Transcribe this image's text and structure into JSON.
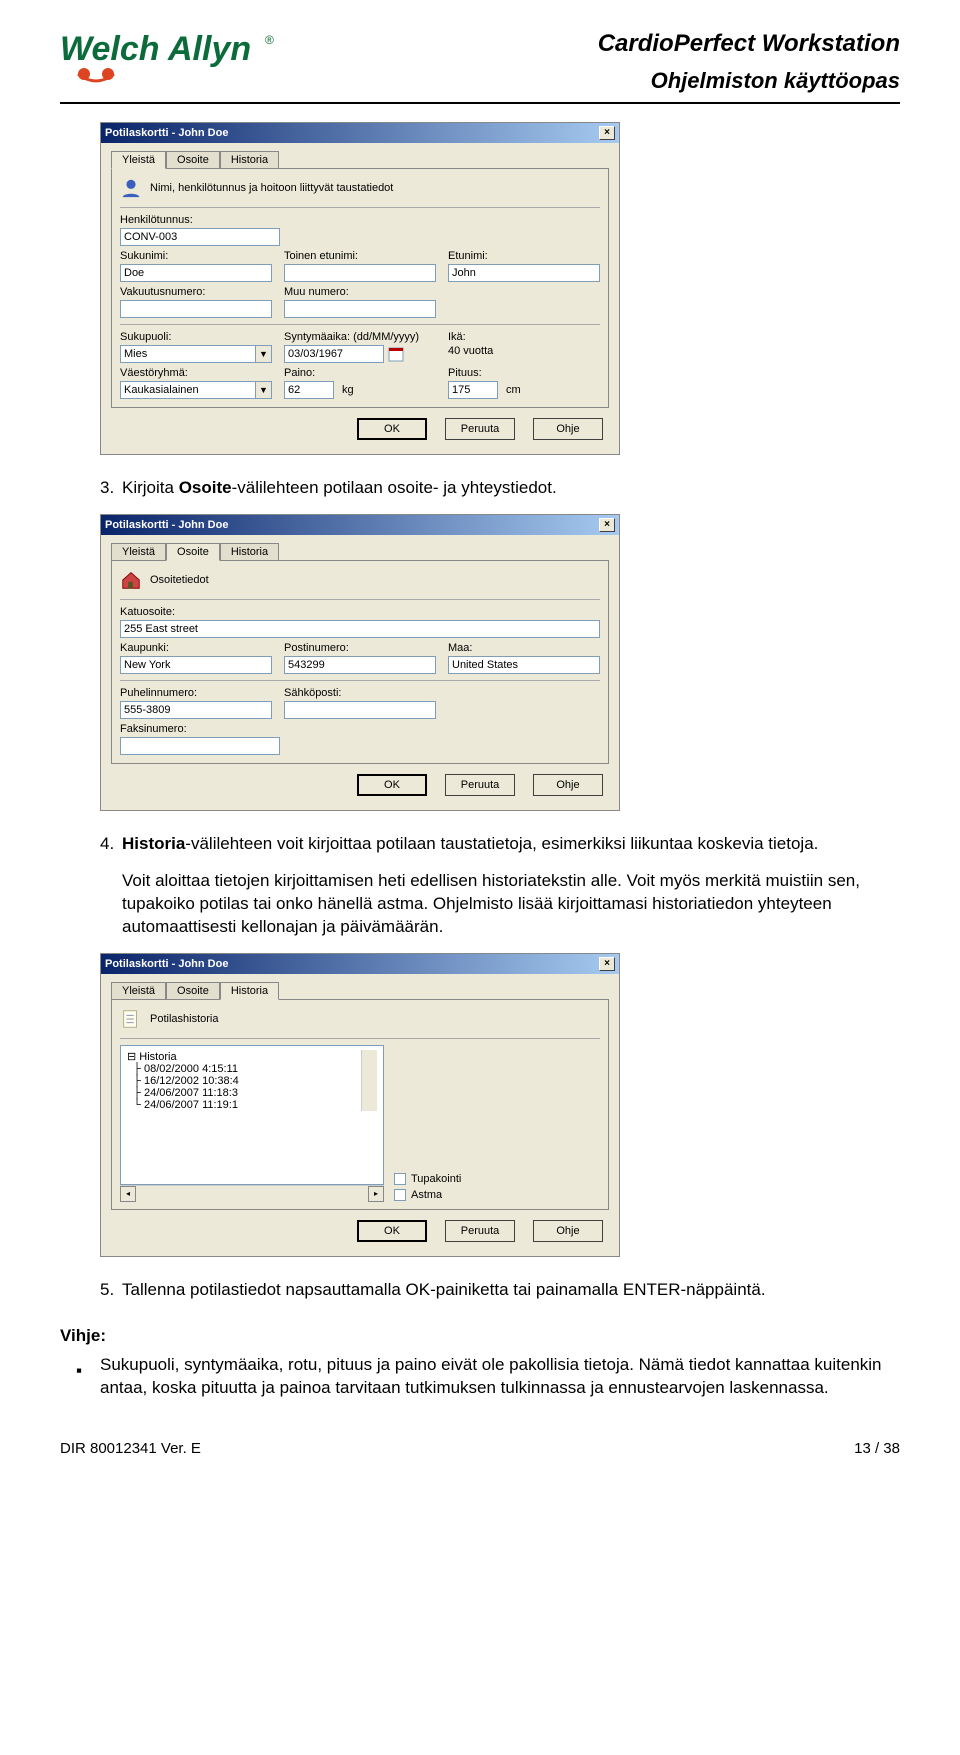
{
  "header": {
    "brand_main": "Welch",
    "brand_sub": "Allyn",
    "title1": "CardioPerfect Workstation",
    "title2": "Ohjelmiston käyttöopas"
  },
  "step3": {
    "num": "3.",
    "pre": "Kirjoita ",
    "bold": "Osoite",
    "post": "-välilehteen potilaan osoite- ja yhteystiedot."
  },
  "step4": {
    "num": "4.",
    "bold": "Historia",
    "post1": "-välilehteen voit kirjoittaa potilaan taustatietoja, esimerkiksi liikuntaa koskevia tietoja.",
    "para": "Voit aloittaa tietojen kirjoittamisen heti edellisen historiatekstin alle. Voit myös merkitä muistiin sen, tupakoiko potilas tai onko hänellä astma. Ohjelmisto lisää kirjoittamasi historiatiedon yhteyteen automaattisesti kellonajan ja päivämäärän."
  },
  "step5": {
    "num": "5.",
    "text": "Tallenna potilastiedot napsauttamalla OK-painiketta tai painamalla ENTER-näppäintä."
  },
  "tip": {
    "label": "Vihje:",
    "body": "Sukupuoli, syntymäaika, rotu, pituus ja paino eivät ole pakollisia tietoja. Nämä tiedot kannattaa kuitenkin antaa, koska pituutta ja painoa tarvitaan tutkimuksen tulkinnassa ja ennustearvojen laskennassa."
  },
  "dlg": {
    "title": "Potilaskortti - John Doe",
    "tabs": {
      "general": "Yleistä",
      "address": "Osoite",
      "history": "Historia"
    },
    "buttons": {
      "ok": "OK",
      "cancel": "Peruuta",
      "help": "Ohje"
    }
  },
  "d1": {
    "panel_caption": "Nimi, henkilötunnus ja hoitoon liittyvät taustatiedot",
    "labels": {
      "hetu": "Henkilötunnus:",
      "sukunimi": "Sukunimi:",
      "toinen": "Toinen etunimi:",
      "etunimi": "Etunimi:",
      "vakuutus": "Vakuutusnumero:",
      "muu": "Muu numero:",
      "sukupuoli": "Sukupuoli:",
      "synt": "Syntymäaika: (dd/MM/yyyy)",
      "ika": "Ikä:",
      "vaesto": "Väestöryhmä:",
      "paino": "Paino:",
      "pituus": "Pituus:"
    },
    "values": {
      "hetu": "CONV-003",
      "sukunimi": "Doe",
      "toinen": "",
      "etunimi": "John",
      "vakuutus": "",
      "muu": "",
      "sukupuoli": "Mies",
      "synt": "03/03/1967",
      "ika": "40 vuotta",
      "vaesto": "Kaukasialainen",
      "paino": "62",
      "paino_unit": "kg",
      "pituus": "175",
      "pituus_unit": "cm"
    }
  },
  "d2": {
    "panel_caption": "Osoitetiedot",
    "labels": {
      "katu": "Katuosoite:",
      "kaupunki": "Kaupunki:",
      "posti": "Postinumero:",
      "maa": "Maa:",
      "puh": "Puhelinnumero:",
      "email": "Sähköposti:",
      "fax": "Faksinumero:"
    },
    "values": {
      "katu": "255 East street",
      "kaupunki": "New York",
      "posti": "543299",
      "maa": "United States",
      "puh": "555-3809",
      "email": "",
      "fax": ""
    }
  },
  "d3": {
    "panel_caption": "Potilashistoria",
    "tree": {
      "root": "Historia",
      "items": [
        "08/02/2000 4:15:11",
        "16/12/2002 10:38:4",
        "24/06/2007 11:18:3",
        "24/06/2007 11:19:1"
      ]
    },
    "checks": {
      "tupakointi": "Tupakointi",
      "astma": "Astma"
    }
  },
  "footer": {
    "left": "DIR 80012341 Ver. E",
    "right": "13 / 38"
  }
}
